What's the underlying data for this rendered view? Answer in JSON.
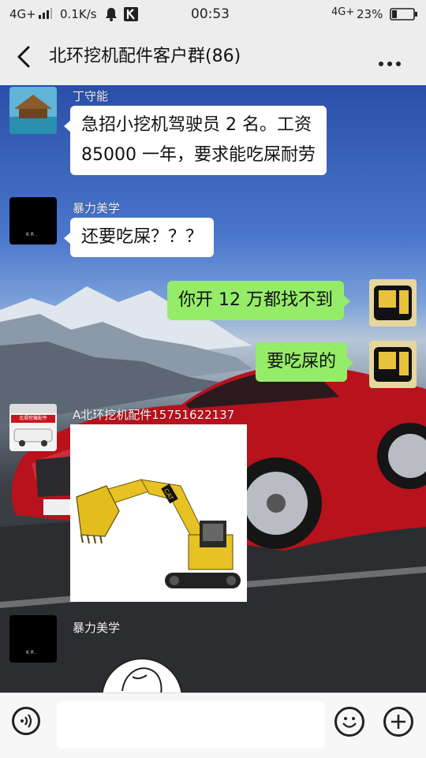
{
  "status_bar": {
    "network_left": "4G+",
    "speed": "0.1K/s",
    "time": "00:53",
    "network_right": "4G+",
    "battery": "23%"
  },
  "header": {
    "title": "北环挖机配件客户群(86)"
  },
  "messages": [
    {
      "sender": "丁守能",
      "side": "left",
      "lines": [
        "急招小挖机驾驶员 2 名。工资",
        "85000 一年，要求能吃屎耐劳"
      ]
    },
    {
      "sender": "暴力美学",
      "side": "left",
      "text": "还要吃屎？？？"
    },
    {
      "side": "right",
      "text": "你开 12 万都找不到"
    },
    {
      "side": "right",
      "text": "要吃屎的"
    },
    {
      "sender": "A北环挖机配件15751622137",
      "side": "left",
      "type": "image",
      "image_desc": "excavator-sticker"
    },
    {
      "sender": "暴力美学",
      "side": "left",
      "type": "partial"
    }
  ],
  "avatar_text": {
    "shop_sign": "北環挖機配件",
    "small_mark": "K R ."
  },
  "sticker": {
    "cat_badge": "CAT"
  },
  "colors": {
    "header_bg": "#ededed",
    "bubble_left": "#ffffff",
    "bubble_right": "#95ec69",
    "sky": "#3a64b8",
    "car_red": "#b8121c"
  },
  "input_bar": {
    "placeholder": ""
  }
}
